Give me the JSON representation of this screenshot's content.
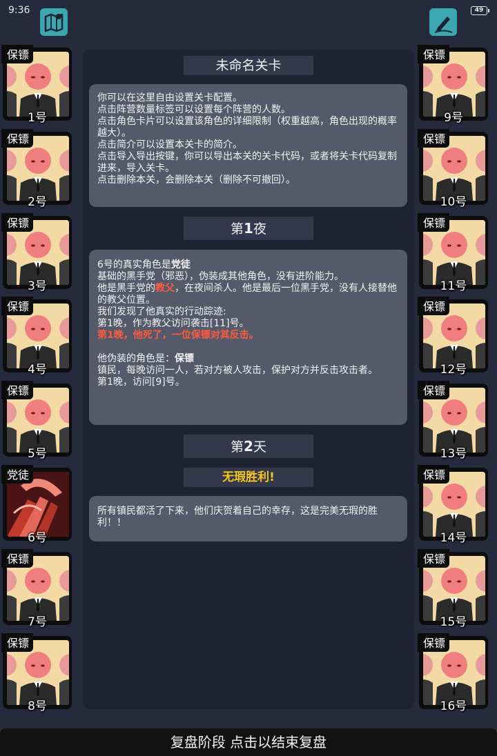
{
  "status": {
    "time": "9:36",
    "battery": "49"
  },
  "icons": {
    "left": "map-icon",
    "right": "edit-icon"
  },
  "level_title": "未命名关卡",
  "intro_lines": [
    "你可以在这里自由设置关卡配置。",
    "点击阵营数量标签可以设置每个阵营的人数。",
    "点击角色卡片可以设置该角色的详细限制（权重越高，角色出现的概率越大）。",
    "点击简介可以设置本关卡的简介。",
    "点击导入导出按键，你可以导出本关的关卡代码，或者将关卡代码复制进来，导入关卡。",
    "点击删除本关，会删除本关（删除不可撤回）。"
  ],
  "night1": {
    "prefix": "第",
    "num": "1",
    "suffix": "夜"
  },
  "night1_log": {
    "l1_pre": "6号的真实角色是",
    "l1_role": "党徒",
    "l2": "基础的黑手党（邪恶），伪装成其他角色，没有进阶能力。",
    "l3_pre": "他是黑手党的",
    "l3_role": "教父",
    "l3_post": "，在夜间杀人。他是最后一位黑手党，没有人接替他的教父位置。",
    "l4": "我们发现了他真实的行动踪迹:",
    "l5": "第1晚，作为教父访问袭击[11]号。",
    "l6": "第1晚，他死了，一位保镖对其反击。",
    "l7_pre": "他伪装的角色是：",
    "l7_role": "保镖",
    "l8": "镇民，每晚访问一人，若对方被人攻击，保护对方并反击攻击者。",
    "l9": "第1晚，访问[9]号。"
  },
  "day2": {
    "prefix": "第",
    "num": "2",
    "suffix": "天"
  },
  "result": "无瑕胜利!",
  "result_text": "所有镇民都活了下来，他们庆贺着自己的幸存，这是完美无瑕的胜利！！",
  "players_left": [
    {
      "role": "保镖",
      "num": "1号"
    },
    {
      "role": "保镖",
      "num": "2号"
    },
    {
      "role": "保镖",
      "num": "3号"
    },
    {
      "role": "保镖",
      "num": "4号"
    },
    {
      "role": "保镖",
      "num": "5号"
    },
    {
      "role": "党徒",
      "num": "6号"
    },
    {
      "role": "保镖",
      "num": "7号"
    },
    {
      "role": "保镖",
      "num": "8号"
    }
  ],
  "players_right": [
    {
      "role": "保镖",
      "num": "9号"
    },
    {
      "role": "保镖",
      "num": "10号"
    },
    {
      "role": "保镖",
      "num": "11号"
    },
    {
      "role": "保镖",
      "num": "12号"
    },
    {
      "role": "保镖",
      "num": "13号"
    },
    {
      "role": "保镖",
      "num": "14号"
    },
    {
      "role": "保镖",
      "num": "15号"
    },
    {
      "role": "保镖",
      "num": "16号"
    }
  ],
  "bottom_label": "复盘阶段 点击以结束复盘",
  "colors": {
    "background": "#262a3d",
    "panel": "#555a6b",
    "highlight_red": "#ff5a3c",
    "win_gold": "#f5c518",
    "icon_teal": "#3aa8ae"
  }
}
